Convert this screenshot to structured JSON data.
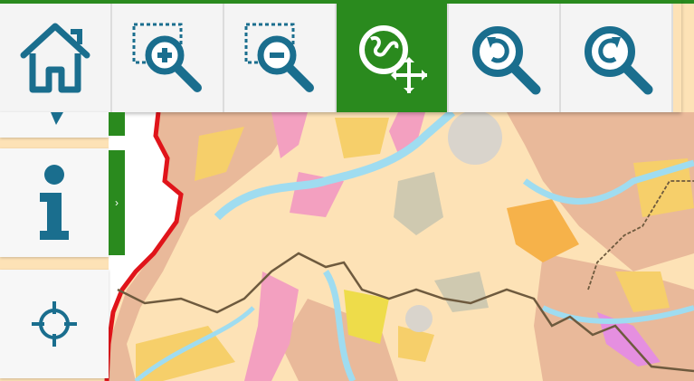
{
  "toolbar": {
    "tools": [
      {
        "icon": "home-icon",
        "active": false
      },
      {
        "icon": "zoom-in-box-icon",
        "active": false
      },
      {
        "icon": "zoom-out-box-icon",
        "active": false
      },
      {
        "icon": "pan-globe-icon",
        "active": true
      },
      {
        "icon": "zoom-previous-icon",
        "active": false
      },
      {
        "icon": "zoom-next-icon",
        "active": false
      }
    ]
  },
  "side_panel": {
    "info_button_icon": "info-icon",
    "expand_tab_glyph": "›",
    "locate_button_icon": "crosshair-icon"
  },
  "colors": {
    "accent": "#2a8a1e",
    "icon": "#1a6e8e",
    "map_base": "#fde2b6",
    "border_red": "#e0141a"
  }
}
